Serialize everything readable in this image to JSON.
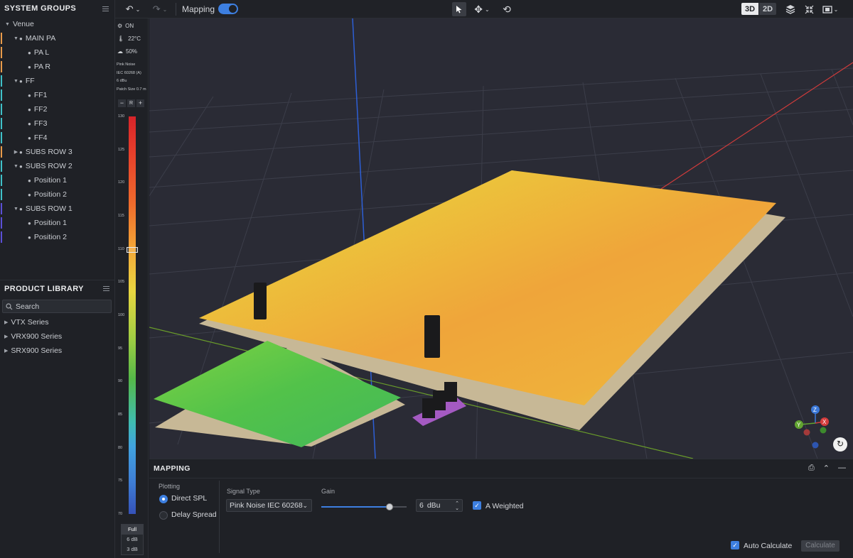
{
  "system_groups": {
    "title": "SYSTEM GROUPS",
    "items": [
      {
        "label": "Venue",
        "level": 0,
        "toggle": "▼",
        "dot": false,
        "bar": ""
      },
      {
        "label": "MAIN PA",
        "level": 1,
        "toggle": "▼",
        "dot": true,
        "bar": "#e99b4a"
      },
      {
        "label": "PA L",
        "level": 2,
        "toggle": "",
        "dot": true,
        "bar": "#e99b4a"
      },
      {
        "label": "PA R",
        "level": 2,
        "toggle": "",
        "dot": true,
        "bar": "#e99b4a"
      },
      {
        "label": "FF",
        "level": 1,
        "toggle": "▼",
        "dot": true,
        "bar": "#3fc1c9"
      },
      {
        "label": "FF1",
        "level": 2,
        "toggle": "",
        "dot": true,
        "bar": "#3fc1c9"
      },
      {
        "label": "FF2",
        "level": 2,
        "toggle": "",
        "dot": true,
        "bar": "#3fc1c9"
      },
      {
        "label": "FF3",
        "level": 2,
        "toggle": "",
        "dot": true,
        "bar": "#3fc1c9"
      },
      {
        "label": "FF4",
        "level": 2,
        "toggle": "",
        "dot": true,
        "bar": "#3fc1c9"
      },
      {
        "label": "SUBS ROW 3",
        "level": 1,
        "toggle": "▶",
        "dot": true,
        "bar": "#e99b4a"
      },
      {
        "label": "SUBS ROW 2",
        "level": 1,
        "toggle": "▼",
        "dot": true,
        "bar": "#3fc1c9"
      },
      {
        "label": "Position 1",
        "level": 2,
        "toggle": "",
        "dot": true,
        "bar": "#3fc1c9"
      },
      {
        "label": "Position 2",
        "level": 2,
        "toggle": "",
        "dot": true,
        "bar": "#3fc1c9"
      },
      {
        "label": "SUBS ROW 1",
        "level": 1,
        "toggle": "▼",
        "dot": true,
        "bar": "#5b4fd6"
      },
      {
        "label": "Position 1",
        "level": 2,
        "toggle": "",
        "dot": true,
        "bar": "#5b4fd6"
      },
      {
        "label": "Position 2",
        "level": 2,
        "toggle": "",
        "dot": true,
        "bar": "#5b4fd6"
      }
    ]
  },
  "product_library": {
    "title": "PRODUCT LIBRARY",
    "search_placeholder": "Search",
    "items": [
      "VTX Series",
      "VRX900 Series",
      "SRX900 Series"
    ]
  },
  "toolbar": {
    "mapping_label": "Mapping",
    "mapping_on": true,
    "view_3d": "3D",
    "view_2d": "2D"
  },
  "legend": {
    "status": "ON",
    "temperature": "22°C",
    "humidity": "50%",
    "signal": "Pink Noise",
    "standard": "IEC 60268 (A)",
    "level": "6 dBu",
    "patch_size": "Patch Size 0.7 m",
    "minus": "−",
    "reset": "R",
    "plus": "+",
    "ticks": [
      "130",
      "125",
      "120",
      "115",
      "110",
      "105",
      "100",
      "95",
      "90",
      "85",
      "80",
      "75",
      "70"
    ],
    "ranges": [
      "Full",
      "6 dB",
      "3 dB"
    ]
  },
  "mapping_panel": {
    "title": "MAPPING",
    "plotting_label": "Plotting",
    "direct_spl": "Direct SPL",
    "delay_spread": "Delay Spread",
    "selected_plot": "Direct SPL",
    "signal_type_label": "Signal Type",
    "signal_type_value": "Pink Noise IEC 60268",
    "gain_label": "Gain",
    "gain_value": "6",
    "gain_unit": "dBu",
    "gain_slider_fraction": 0.8,
    "a_weighted_label": "A Weighted",
    "a_weighted": true,
    "auto_calculate_label": "Auto Calculate",
    "auto_calculate": true,
    "calculate_label": "Calculate"
  },
  "gizmo": {
    "z": "Z",
    "y": "Y",
    "x": "X"
  },
  "colors": {
    "accent": "#3d7fe0"
  }
}
